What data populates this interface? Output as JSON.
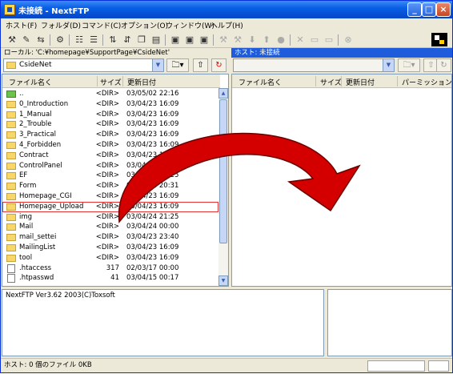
{
  "window": {
    "title": "未接続 - NextFTP"
  },
  "menu": [
    "ホスト(F)",
    "フォルダ(D)",
    "コマンド(C)",
    "オプション(O)",
    "ウィンドウ(W)",
    "ヘルプ(H)"
  ],
  "local": {
    "path_label": "ローカル: 'C:¥homepage¥SupportPage¥CsideNet'",
    "current_dir": "CsideNet",
    "columns": {
      "name": "ファイル名く",
      "size": "サイズ",
      "date": "更新日付"
    },
    "rows": [
      {
        "name": "..",
        "size": "<DIR>",
        "date": "03/05/02 22:16",
        "kind": "up"
      },
      {
        "name": "0_Introduction",
        "size": "<DIR>",
        "date": "03/04/23 16:09",
        "kind": "dir"
      },
      {
        "name": "1_Manual",
        "size": "<DIR>",
        "date": "03/04/23 16:09",
        "kind": "dir"
      },
      {
        "name": "2_Trouble",
        "size": "<DIR>",
        "date": "03/04/23 16:09",
        "kind": "dir"
      },
      {
        "name": "3_Practical",
        "size": "<DIR>",
        "date": "03/04/23 16:09",
        "kind": "dir"
      },
      {
        "name": "4_Forbidden",
        "size": "<DIR>",
        "date": "03/04/23 16:09",
        "kind": "dir"
      },
      {
        "name": "Contract",
        "size": "<DIR>",
        "date": "03/04/23 16:09",
        "kind": "dir"
      },
      {
        "name": "ControlPanel",
        "size": "<DIR>",
        "date": "03/04/23 16:09",
        "kind": "dir"
      },
      {
        "name": "EF",
        "size": "<DIR>",
        "date": "03/04/24 00:25",
        "kind": "dir"
      },
      {
        "name": "Form",
        "size": "<DIR>",
        "date": "03/04/24 20:31",
        "kind": "dir"
      },
      {
        "name": "Homepage_CGI",
        "size": "<DIR>",
        "date": "03/04/23 16:09",
        "kind": "dir"
      },
      {
        "name": "Homepage_Upload",
        "size": "<DIR>",
        "date": "03/04/23 16:09",
        "kind": "dir",
        "highlight": true
      },
      {
        "name": "img",
        "size": "<DIR>",
        "date": "03/04/24 21:25",
        "kind": "dir"
      },
      {
        "name": "Mail",
        "size": "<DIR>",
        "date": "03/04/24 00:00",
        "kind": "dir"
      },
      {
        "name": "mail_settei",
        "size": "<DIR>",
        "date": "03/04/23 23:40",
        "kind": "dir"
      },
      {
        "name": "MailingList",
        "size": "<DIR>",
        "date": "03/04/23 16:09",
        "kind": "dir"
      },
      {
        "name": "tool",
        "size": "<DIR>",
        "date": "03/04/23 16:09",
        "kind": "dir"
      },
      {
        "name": ".htaccess",
        "size": "317",
        "date": "02/03/17 00:00",
        "kind": "file"
      },
      {
        "name": ".htpasswd",
        "size": "41",
        "date": "03/04/15 00:17",
        "kind": "file"
      }
    ]
  },
  "remote": {
    "path_label": "ホスト: 未接続",
    "columns": {
      "name": "ファイル名く",
      "size": "サイズ",
      "date": "更新日付",
      "perm": "パーミッション"
    }
  },
  "log": {
    "text": "NextFTP Ver3.62 2003(C)Toxsoft"
  },
  "status": {
    "text": "ホスト: 0 個のファイル  0KB"
  },
  "colors": {
    "accent": "#1f5cdb",
    "arrow": "#d40000",
    "highlight": "#e23333"
  },
  "icons": [
    "app-icon",
    "folder-icon",
    "file-icon",
    "up-folder-icon",
    "arrow-right-icon"
  ]
}
